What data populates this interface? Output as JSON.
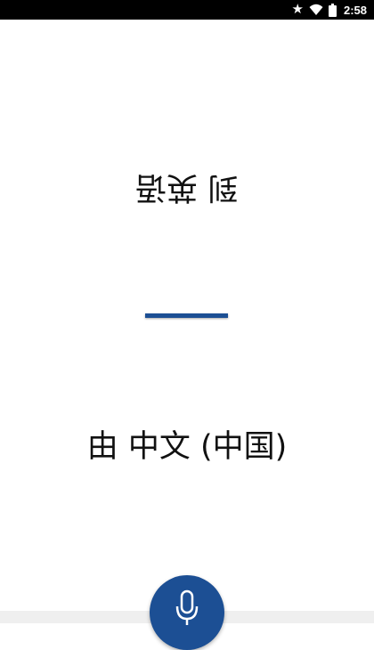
{
  "status_bar": {
    "time": "2:58",
    "icons": [
      "star-icon",
      "wifi-icon",
      "battery-icon"
    ]
  },
  "translation": {
    "target_language_label": "到 英语",
    "source_language_label": "由 中文 (中国)"
  },
  "mic_button": {
    "icon": "microphone-icon"
  },
  "colors": {
    "accent": "#1c4f94",
    "status_bar_bg": "#000000",
    "background": "#ffffff",
    "bottom_bar": "#efefef"
  }
}
